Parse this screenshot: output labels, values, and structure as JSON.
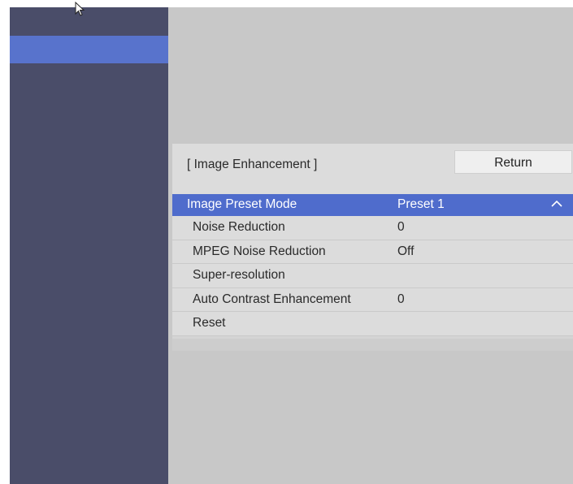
{
  "sidebar": {
    "selected_index": 1
  },
  "panel": {
    "title": "[ Image Enhancement ]",
    "return_label": "Return",
    "rows": [
      {
        "label": "Image Preset Mode",
        "value": "Preset 1",
        "highlighted": true
      },
      {
        "label": "Noise Reduction",
        "value": "0"
      },
      {
        "label": "MPEG Noise Reduction",
        "value": "Off"
      },
      {
        "label": "Super-resolution",
        "value": ""
      },
      {
        "label": "Auto Contrast Enhancement",
        "value": "0"
      },
      {
        "label": "Reset",
        "value": ""
      }
    ]
  },
  "colors": {
    "sidebar": "#4a4d69",
    "highlight": "#4f6ccc",
    "main_bg": "#c8c8c8"
  },
  "icons": {
    "cursor": "mouse-pointer-icon",
    "chevron": "chevron-up-icon"
  }
}
